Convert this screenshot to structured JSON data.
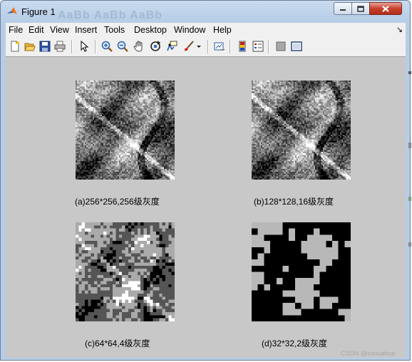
{
  "window": {
    "title": "Figure 1",
    "ghost_title": "AaBb AaBb AaBb"
  },
  "menu": [
    {
      "label": "File",
      "key": "file"
    },
    {
      "label": "Edit",
      "key": "edit"
    },
    {
      "label": "View",
      "key": "view"
    },
    {
      "label": "Insert",
      "key": "insert"
    },
    {
      "label": "Tools",
      "key": "tools"
    },
    {
      "label": "Desktop",
      "key": "desktop"
    },
    {
      "label": "Window",
      "key": "window"
    },
    {
      "label": "Help",
      "key": "help"
    }
  ],
  "toolbar": [
    "new-figure-icon",
    "open-file-icon",
    "save-icon",
    "print-icon",
    "select-arrow-icon",
    "zoom-in-icon",
    "zoom-out-icon",
    "pan-hand-icon",
    "rotate-3d-icon",
    "data-cursor-icon",
    "brush-icon",
    "link-plot-icon",
    "colorbar-icon",
    "legend-icon",
    "hide-plot-tools-icon",
    "show-plot-tools-icon"
  ],
  "subplots": [
    {
      "key": "a",
      "caption": "(a)256*256,256级灰度",
      "grid": 64,
      "levels": 256
    },
    {
      "key": "b",
      "caption": "(b)128*128,16级灰度",
      "grid": 64,
      "levels": 16
    },
    {
      "key": "c",
      "caption": "(c)64*64,4级灰度",
      "grid": 32,
      "levels": 4
    },
    {
      "key": "d",
      "caption": "(d)32*32,2级灰度",
      "grid": 16,
      "levels": 2
    }
  ],
  "watermark": "CSDN @sonuahue",
  "colors": {
    "figure_background": "#c8c8c8",
    "menubar": "#f0f0f0",
    "title_gradient": "#b6cde6"
  }
}
